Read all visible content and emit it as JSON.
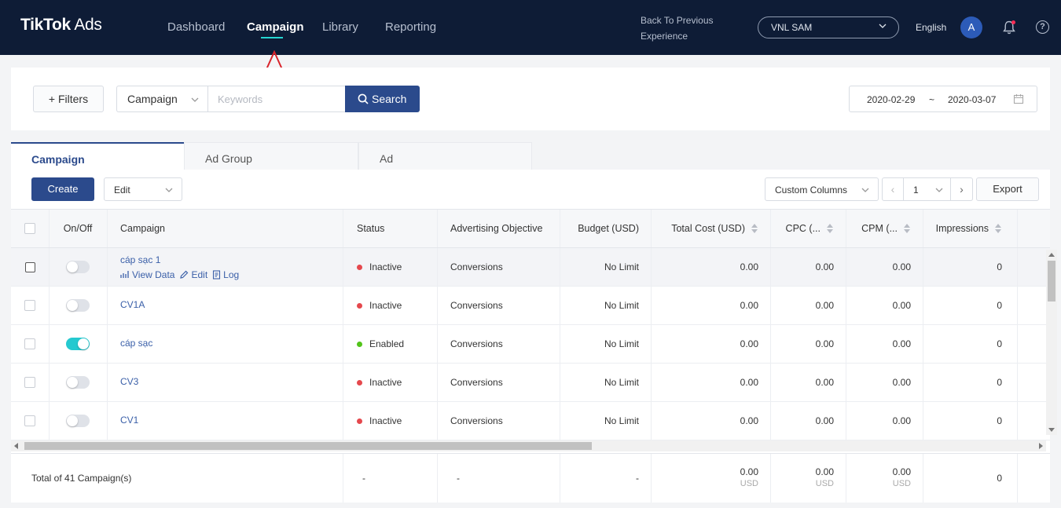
{
  "nav": {
    "logo_main": "TikTok",
    "logo_suffix": " Ads",
    "items": [
      "Dashboard",
      "Campaign",
      "Library",
      "Reporting"
    ],
    "active": "Campaign",
    "back_link": "Back To Previous Experience",
    "account": "VNL SAM",
    "language": "English",
    "avatar_initial": "A",
    "help_glyph": "?"
  },
  "filters": {
    "filters_label": "Filters",
    "type_value": "Campaign",
    "keywords_placeholder": "Keywords",
    "search_label": "Search",
    "date_start": "2020-02-29",
    "date_sep": "~",
    "date_end": "2020-03-07"
  },
  "tabs": [
    "Campaign",
    "Ad Group",
    "Ad"
  ],
  "toolbar": {
    "create_label": "Create",
    "edit_label": "Edit",
    "custom_columns_label": "Custom Columns",
    "page_prev": "‹",
    "page_value": "1",
    "page_next": "›",
    "export_label": "Export"
  },
  "table": {
    "headers": {
      "onoff": "On/Off",
      "campaign": "Campaign",
      "status": "Status",
      "objective": "Advertising Objective",
      "budget": "Budget (USD)",
      "cost": "Total Cost (USD)",
      "cpc": "CPC (...",
      "cpm": "CPM (...",
      "impressions": "Impressions"
    },
    "row_actions": {
      "view_data": "View Data",
      "edit": "Edit",
      "log": "Log"
    },
    "rows": [
      {
        "name": "cáp sạc 1",
        "on": false,
        "status": "Inactive",
        "status_color": "#e5484d",
        "objective": "Conversions",
        "budget": "No Limit",
        "cost": "0.00",
        "cpc": "0.00",
        "cpm": "0.00",
        "impressions": "0"
      },
      {
        "name": "CV1A",
        "on": false,
        "status": "Inactive",
        "status_color": "#e5484d",
        "objective": "Conversions",
        "budget": "No Limit",
        "cost": "0.00",
        "cpc": "0.00",
        "cpm": "0.00",
        "impressions": "0"
      },
      {
        "name": "cáp sạc",
        "on": true,
        "status": "Enabled",
        "status_color": "#52c41a",
        "objective": "Conversions",
        "budget": "No Limit",
        "cost": "0.00",
        "cpc": "0.00",
        "cpm": "0.00",
        "impressions": "0"
      },
      {
        "name": "CV3",
        "on": false,
        "status": "Inactive",
        "status_color": "#e5484d",
        "objective": "Conversions",
        "budget": "No Limit",
        "cost": "0.00",
        "cpc": "0.00",
        "cpm": "0.00",
        "impressions": "0"
      },
      {
        "name": "CV1",
        "on": false,
        "status": "Inactive",
        "status_color": "#e5484d",
        "objective": "Conversions",
        "budget": "No Limit",
        "cost": "0.00",
        "cpc": "0.00",
        "cpm": "0.00",
        "impressions": "0"
      }
    ]
  },
  "totals": {
    "label": "Total of 41 Campaign(s)",
    "status": "-",
    "objective": "-",
    "budget": "-",
    "cost": "0.00",
    "cpc": "0.00",
    "cpm": "0.00",
    "currency": "USD",
    "impressions": "0"
  },
  "colors": {
    "nav_bg": "#0e1c36",
    "accent": "#2b4a8c",
    "nav_underline": "#25d5d1",
    "toggle_on": "#25c9d0",
    "annotation": "#d9242b"
  }
}
